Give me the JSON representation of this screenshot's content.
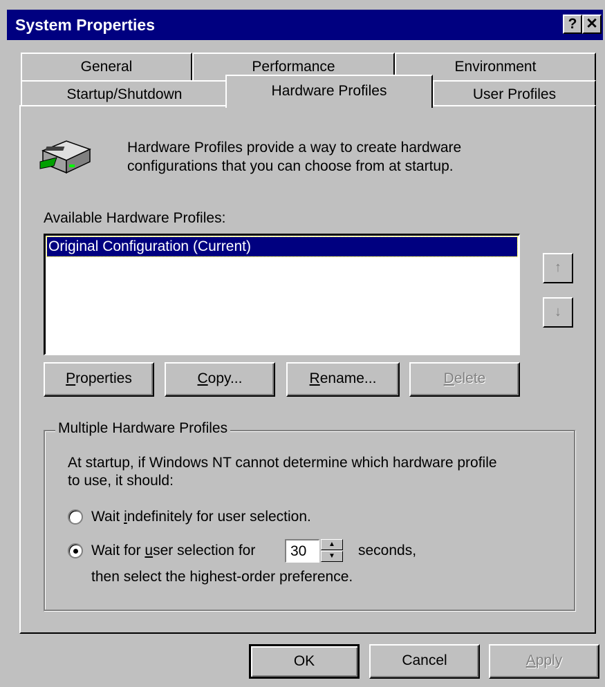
{
  "window": {
    "title": "System Properties",
    "help_label": "?",
    "close_label": "✕"
  },
  "tabs": {
    "row_back": [
      {
        "label": "General"
      },
      {
        "label": "Performance"
      },
      {
        "label": "Environment"
      }
    ],
    "row_front": [
      {
        "label": "Startup/Shutdown"
      },
      {
        "label": "Hardware Profiles",
        "active": true
      },
      {
        "label": "User Profiles"
      }
    ]
  },
  "intro": {
    "icon": "hardware-profile-icon",
    "line1": "Hardware Profiles provide a way to create hardware",
    "line2": "configurations that you can choose from at startup."
  },
  "profiles": {
    "label": "Available Hardware Profiles:",
    "items": [
      {
        "name": "Original Configuration (Current)",
        "selected": true
      }
    ],
    "move_up_icon": "up-arrow-icon",
    "move_down_icon": "down-arrow-icon"
  },
  "profile_buttons": {
    "properties": {
      "first": "P",
      "rest": "roperties"
    },
    "copy": {
      "first": "C",
      "rest": "opy..."
    },
    "rename": {
      "first": "R",
      "rest": "ename..."
    },
    "delete": {
      "first": "D",
      "rest": "elete",
      "disabled": true
    }
  },
  "multiple": {
    "group_label": "Multiple Hardware Profiles",
    "desc1": "At startup, if Windows NT cannot determine which hardware profile",
    "desc2": "to use, it should:",
    "option1": {
      "pre": "Wait ",
      "acc": "i",
      "post": "ndefinitely for user selection.",
      "checked": false
    },
    "option2": {
      "pre": "Wait for ",
      "acc": "u",
      "post": "ser selection for",
      "checked": true
    },
    "seconds_value": "30",
    "seconds_label": "seconds,",
    "then_text": "then select the highest-order preference."
  },
  "footer": {
    "ok": "OK",
    "cancel": "Cancel",
    "apply": {
      "first": "A",
      "rest": "pply",
      "disabled": true
    }
  }
}
